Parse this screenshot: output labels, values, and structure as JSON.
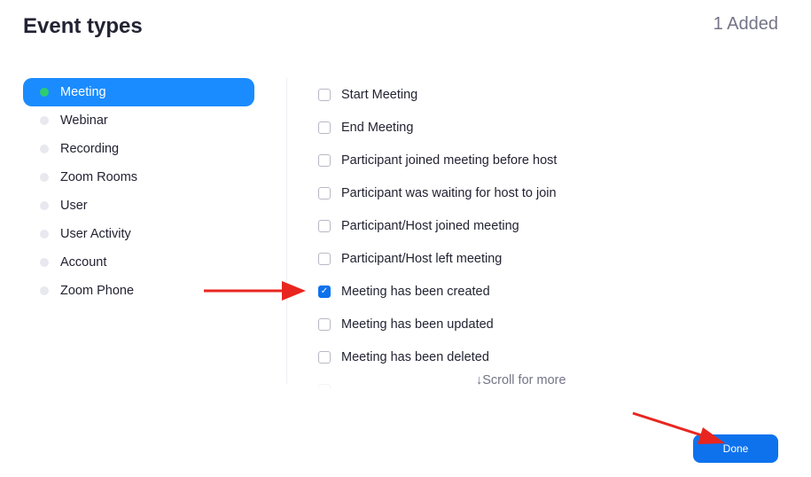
{
  "header": {
    "title": "Event types",
    "added_count": "1 Added"
  },
  "sidebar": {
    "items": [
      {
        "label": "Meeting",
        "active": true
      },
      {
        "label": "Webinar"
      },
      {
        "label": "Recording"
      },
      {
        "label": "Zoom Rooms"
      },
      {
        "label": "User"
      },
      {
        "label": "User Activity"
      },
      {
        "label": "Account"
      },
      {
        "label": "Zoom Phone"
      }
    ]
  },
  "events": {
    "items": [
      {
        "label": "Start Meeting",
        "checked": false
      },
      {
        "label": "End Meeting",
        "checked": false
      },
      {
        "label": "Participant joined meeting before host",
        "checked": false
      },
      {
        "label": "Participant was waiting for host to join",
        "checked": false
      },
      {
        "label": "Participant/Host joined meeting",
        "checked": false
      },
      {
        "label": "Participant/Host left meeting",
        "checked": false
      },
      {
        "label": "Meeting has been created",
        "checked": true
      },
      {
        "label": "Meeting has been updated",
        "checked": false
      },
      {
        "label": "Meeting has been deleted",
        "checked": false
      }
    ],
    "scroll_hint": "↓Scroll for more"
  },
  "footer": {
    "done_label": "Done"
  },
  "colors": {
    "accent": "#0e72ed",
    "sidebar_active": "#1a8cff",
    "status_dot": "#2ecc71",
    "annotation_arrow": "#e8261f"
  }
}
